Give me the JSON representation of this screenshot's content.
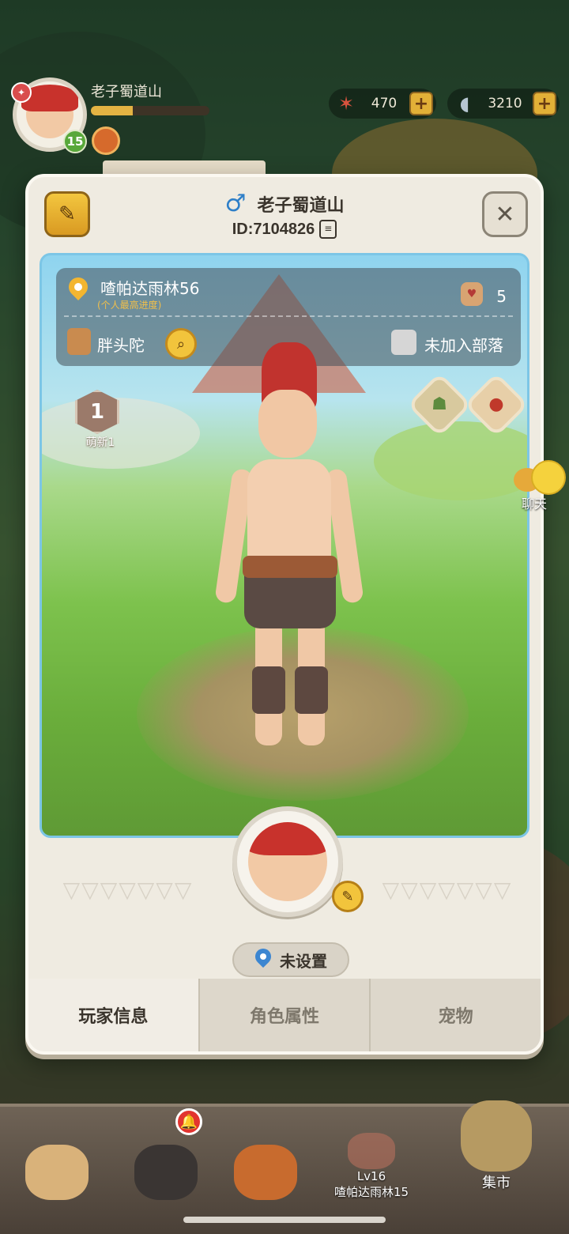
{
  "hud": {
    "player_name": "老子蜀道山",
    "level": "15",
    "exp_fraction": 0.35,
    "currency_1_value": "470",
    "currency_2_value": "3210",
    "plus_label": "+"
  },
  "modal": {
    "player_name": "老子蜀道山",
    "gender_icon": "male-icon",
    "id_text": "ID:7104826",
    "close_label": "✕",
    "info": {
      "location_name": "喳帕达雨林56",
      "location_sub": "(个人最高进度)",
      "likes": "5",
      "title": "胖头陀",
      "tribe": "未加入部落"
    },
    "rank": {
      "number": "1",
      "label": "萌新1"
    },
    "set_location_label": "未设置",
    "tabs": [
      {
        "label": "玩家信息",
        "active": true
      },
      {
        "label": "角色属性",
        "active": false
      },
      {
        "label": "宠物",
        "active": false
      }
    ]
  },
  "chat": {
    "label": "聊天"
  },
  "bottom_nav": {
    "notify_icon": "bell-icon",
    "locked_level": "Lv16",
    "locked_place": "喳帕达雨林15",
    "market_label": "集市"
  },
  "colors": {
    "accent_gold": "#e2b037",
    "panel_bg": "#efebe1",
    "gender_blue": "#2e7fc8"
  }
}
